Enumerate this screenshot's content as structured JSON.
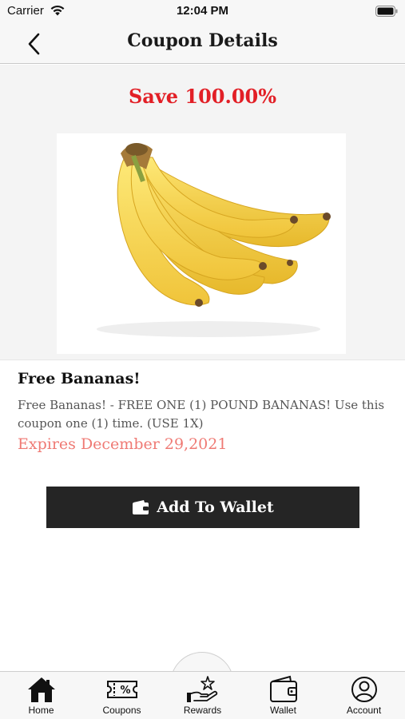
{
  "status_bar": {
    "carrier": "Carrier",
    "time": "12:04 PM"
  },
  "nav": {
    "title": "Coupon Details"
  },
  "coupon": {
    "save_text": "Save 100.00%",
    "title": "Free Bananas!",
    "description": "Free Bananas! - FREE ONE (1) POUND BANANAS! Use this coupon one (1) time. (USE 1X)",
    "expiry": "Expires December 29,2021"
  },
  "actions": {
    "add_to_wallet": "Add To Wallet"
  },
  "tab_bar": {
    "items": [
      {
        "label": "Home",
        "icon": "home-icon"
      },
      {
        "label": "Coupons",
        "icon": "coupon-ticket-icon"
      },
      {
        "label": "Rewards",
        "icon": "rewards-hand-star-icon"
      },
      {
        "label": "Wallet",
        "icon": "wallet-icon"
      },
      {
        "label": "Account",
        "icon": "account-icon"
      }
    ]
  },
  "colors": {
    "accent_red": "#e21f26",
    "expiry_pink": "#ef7a74",
    "button_dark": "#252525"
  }
}
